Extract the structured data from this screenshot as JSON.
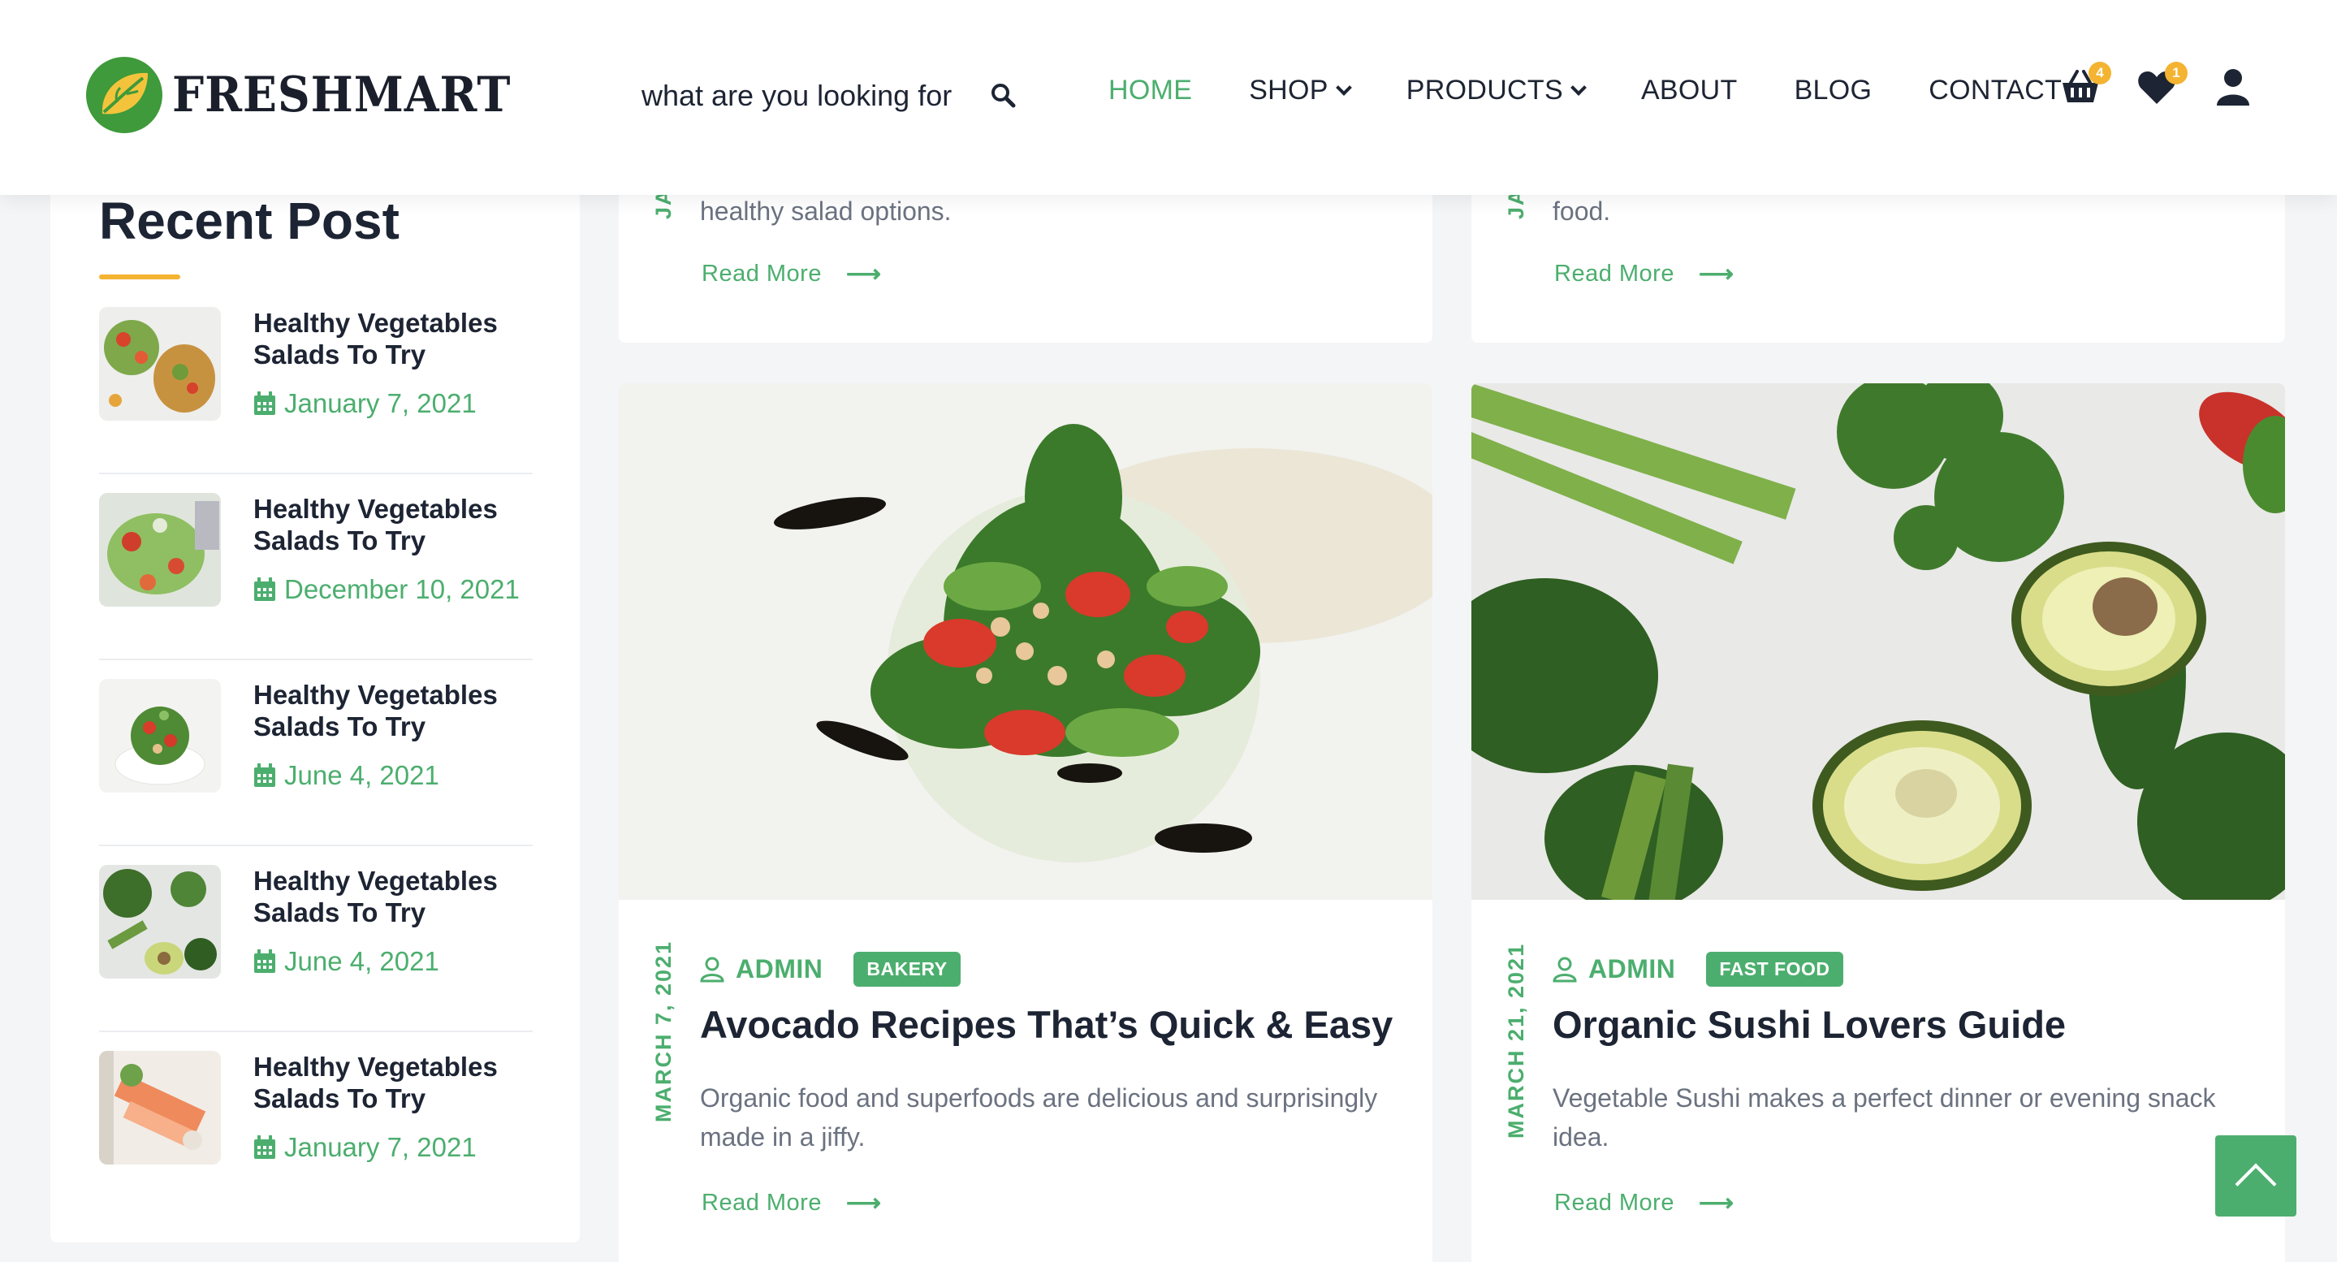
{
  "header": {
    "logo_text": "FRESHMART",
    "search_placeholder": "what are you looking for",
    "nav": [
      {
        "label": "HOME",
        "active": true
      },
      {
        "label": "SHOP",
        "dropdown": true
      },
      {
        "label": "PRODUCTS",
        "dropdown": true
      },
      {
        "label": "ABOUT"
      },
      {
        "label": "BLOG"
      },
      {
        "label": "CONTACT"
      }
    ],
    "cart_count": "4",
    "wishlist_count": "1",
    "icons": [
      "search-icon",
      "cart-icon",
      "heart-icon",
      "user-icon"
    ]
  },
  "sidebar": {
    "title": "Recent Post",
    "posts": [
      {
        "title": "Healthy Vegetables Salads To Try",
        "date": "January 7, 2021"
      },
      {
        "title": "Healthy Vegetables Salads To Try",
        "date": "December 10, 2021"
      },
      {
        "title": "Healthy Vegetables Salads To Try",
        "date": "June 4, 2021"
      },
      {
        "title": "Healthy Vegetables Salads To Try",
        "date": "June 4, 2021"
      },
      {
        "title": "Healthy Vegetables Salads To Try",
        "date": "January 7, 2021"
      }
    ]
  },
  "top_cards": [
    {
      "date_partial": "JA",
      "excerpt_tail": "healthy salad options.",
      "read_more": "Read More"
    },
    {
      "date_partial": "JA",
      "excerpt_tail": "food.",
      "read_more": "Read More"
    }
  ],
  "cards": [
    {
      "date": "MARCH 7, 2021",
      "author": "ADMIN",
      "tag": "BAKERY",
      "title": "Avocado Recipes That’s Quick & Easy",
      "excerpt": "Organic food and superfoods are delicious and surprisingly made in a jiffy.",
      "read_more": "Read More"
    },
    {
      "date": "MARCH 21, 2021",
      "author": "ADMIN",
      "tag": "FAST FOOD",
      "title": "Organic Sushi Lovers Guide",
      "excerpt": "Vegetable Sushi makes a perfect dinner or evening snack idea.",
      "read_more": "Read More"
    }
  ],
  "colors": {
    "accent": "#4cae6e",
    "highlight": "#f4b331",
    "text": "#1d2433",
    "muted": "#6b7280"
  }
}
